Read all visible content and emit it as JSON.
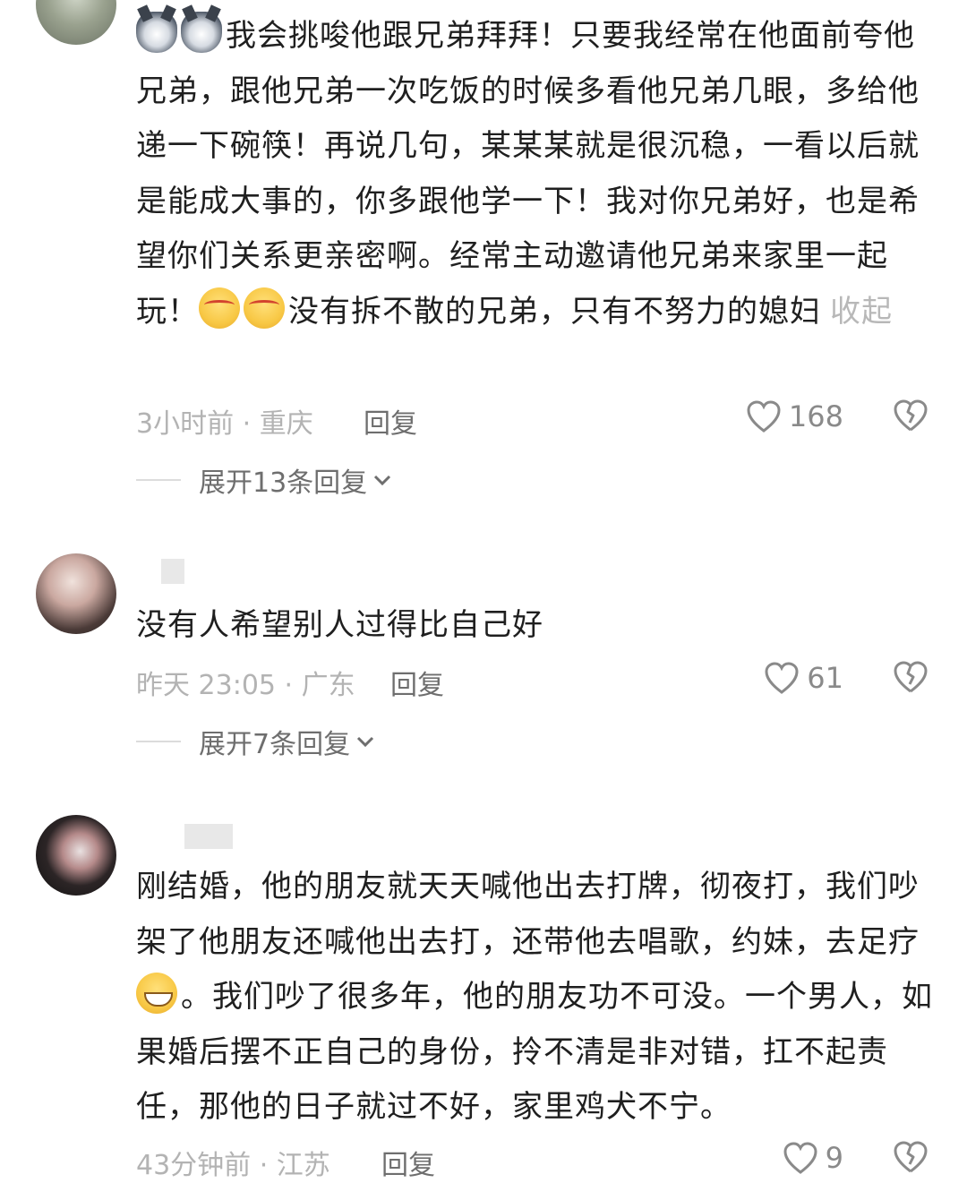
{
  "comments": [
    {
      "text_segments": [
        "我会挑唆他跟兄弟拜拜！只要我经常在他面前夸他兄弟，跟他兄弟一次吃饭的时候多看他兄弟几眼，多给他递一下碗筷！再说几句，某某某就是很沉稳，一看以后就是能成大事的，你多跟他学一下！我对你兄弟好，也是希望你们关系更亲密啊。经常主动邀请他兄弟来家里一起玩！",
        "没有拆不散的兄弟，只有不努力的媳妇"
      ],
      "collapse_label": "收起",
      "time_location": "3小时前 · 重庆",
      "reply_label": "回复",
      "likes": "168",
      "expand_label": "展开13条回复"
    },
    {
      "text": "没有人希望别人过得比自己好",
      "time_location": "昨天 23:05 · 广东",
      "reply_label": "回复",
      "likes": "61",
      "expand_label": "展开7条回复"
    },
    {
      "text_segments": [
        "刚结婚，他的朋友就天天喊他出去打牌，彻夜打，我们吵架了他朋友还喊他出去打，还带他去唱歌，约妹，去足疗",
        "。我们吵了很多年，他的朋友功不可没。一个男人，如果婚后摆不正自己的身份，拎不清是非对错，扛不起责任，那他的日子就过不好，家里鸡犬不宁。"
      ],
      "time_location": "43分钟前 · 江苏",
      "reply_label": "回复",
      "likes": "9"
    }
  ],
  "icons": [
    "heart-icon",
    "broken-heart-icon",
    "chevron-down-icon"
  ],
  "colors": {
    "meta_gray": "#b3b3b3",
    "reply_gray": "#6e6e6e",
    "text": "#1f1f1f"
  }
}
